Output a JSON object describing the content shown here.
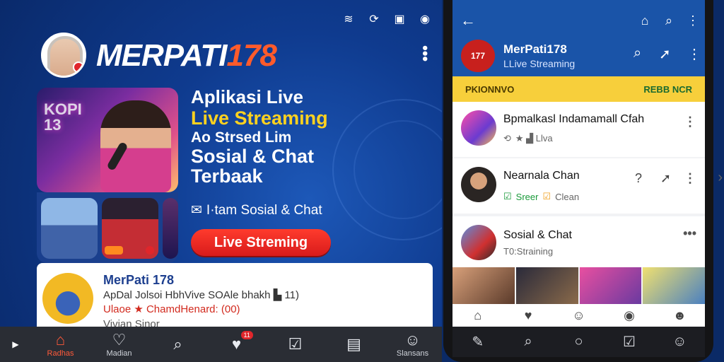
{
  "left": {
    "brand": {
      "name": "MERPATI",
      "number": "178"
    },
    "hero": {
      "neon_text": "KOPI 13",
      "line1": "Aplikasi Live",
      "line2": "Live Streaming",
      "line3": "Ao Strsed Lim",
      "line4": "Sosial & Chat",
      "line5": "Terbaak",
      "subline": "I·tam Sosial & Chat",
      "button": "Live Streming"
    },
    "card": {
      "title": "MerPati 178",
      "line2": "ApDal Jolsoi HbhVive SOAle bhakh  ▙ 11)",
      "line3": "Ulaoe ★ ChamdHenard: (00)",
      "line4": "Vivian Sinor"
    },
    "nav": [
      {
        "label": "Radhas",
        "icon": "home-icon",
        "glyph": "⌂"
      },
      {
        "label": "Madian",
        "icon": "heart-icon",
        "glyph": "♡"
      },
      {
        "label": "",
        "icon": "search-icon",
        "glyph": "⌕"
      },
      {
        "label": "",
        "icon": "love-icon",
        "glyph": "♥",
        "badge": "11"
      },
      {
        "label": "",
        "icon": "check-heart-icon",
        "glyph": "☑"
      },
      {
        "label": "",
        "icon": "note-icon",
        "glyph": "▤"
      },
      {
        "label": "Slansans",
        "icon": "profile-icon",
        "glyph": "☺"
      }
    ]
  },
  "phone": {
    "header": {
      "name": "MerPati178",
      "subtitle": "LLive Streaming",
      "logo_text": "177"
    },
    "banner": {
      "left": "PKIONNVO",
      "right": "REBB NCR"
    },
    "rows": [
      {
        "title": "Bpmalkasl Indamamall Cfah",
        "meta": "★  ▟ Llva"
      },
      {
        "title": "Nearnala Chan",
        "meta_green": "Sreer",
        "meta_orange": "Clean"
      },
      {
        "title": "Sosial & Chat",
        "meta": "T0:Straining"
      }
    ]
  },
  "colors": {
    "brand_blue": "#1a54a8",
    "accent_red": "#e0262b",
    "accent_yellow": "#ffd21f",
    "banner_yellow": "#f7cf3b"
  }
}
